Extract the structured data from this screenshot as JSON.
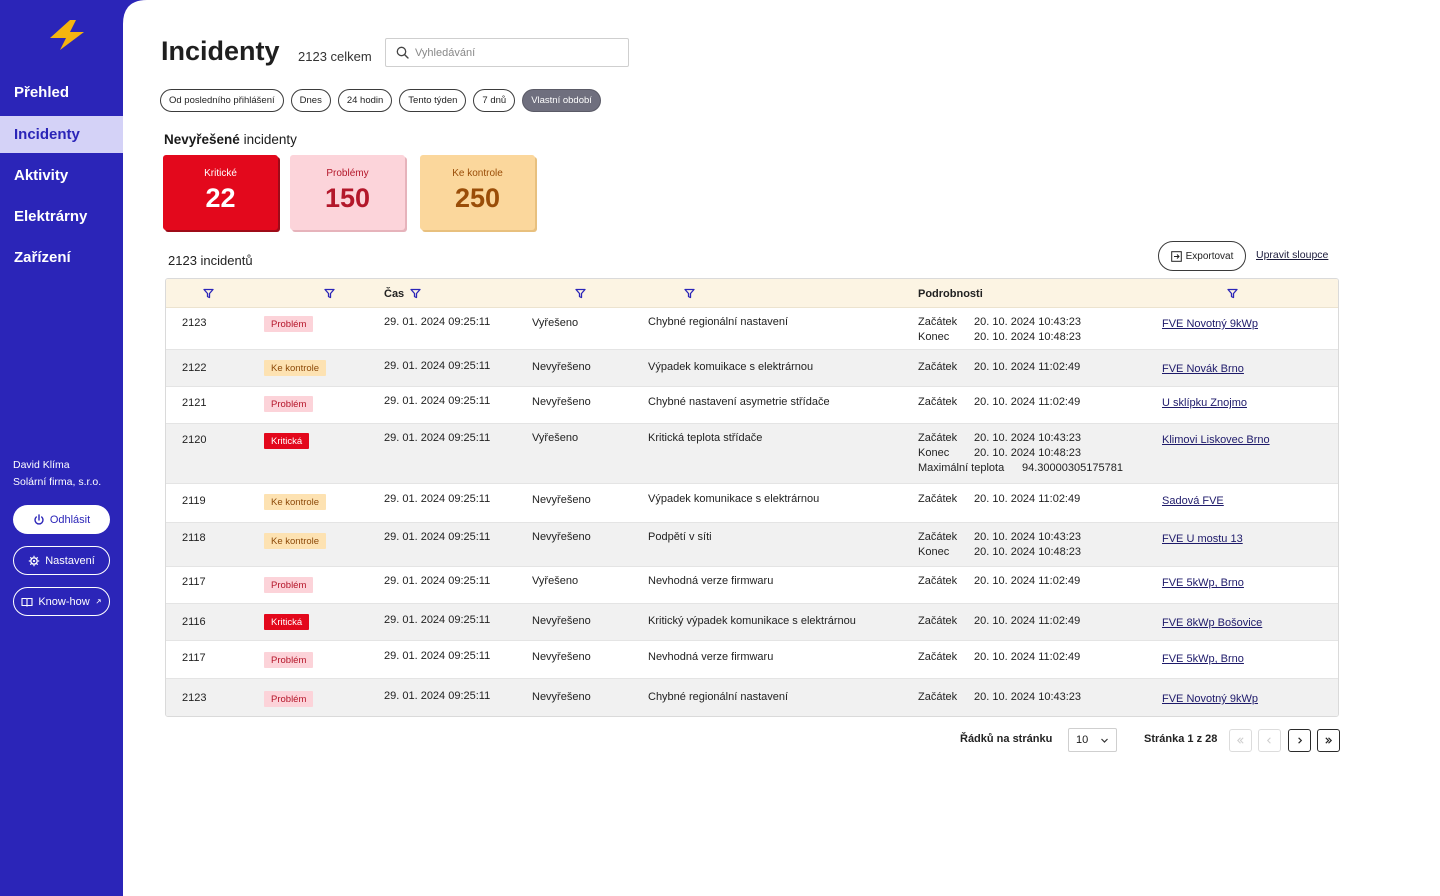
{
  "sidebar": {
    "items": [
      {
        "label": "Přehled"
      },
      {
        "label": "Incidenty"
      },
      {
        "label": "Aktivity"
      },
      {
        "label": "Elektrárny"
      },
      {
        "label": "Zařízení"
      }
    ],
    "user_name": "David Klíma",
    "company": "Solární firma, s.r.o.",
    "logout_label": "Odhlásit",
    "settings_label": "Nastavení",
    "knowhow_label": "Know-how",
    "brand_color": "#2b25b8"
  },
  "header": {
    "title": "Incidenty",
    "total": "2123 celkem",
    "search_placeholder": "Vyhledávání"
  },
  "time_filters": [
    {
      "label": "Od posledního přihlášení",
      "active": false
    },
    {
      "label": "Dnes",
      "active": false
    },
    {
      "label": "24 hodin",
      "active": false
    },
    {
      "label": "Tento týden",
      "active": false
    },
    {
      "label": "7 dnů",
      "active": false
    },
    {
      "label": "Vlastní období",
      "active": true
    }
  ],
  "unresolved": {
    "title_bold": "Nevyřešené",
    "title_rest": " incidenty",
    "cards": [
      {
        "label": "Kritické",
        "value": "22",
        "color": "#e3081c"
      },
      {
        "label": "Problémy",
        "value": "150",
        "color": "#fcd4da"
      },
      {
        "label": "Ke kontrole",
        "value": "250",
        "color": "#fbd79c"
      }
    ]
  },
  "table": {
    "count_label": "2123 incidentů",
    "export_label": "Exportovat",
    "edit_columns_label": "Upravit sloupce",
    "headers": {
      "time": "Čas",
      "details": "Podrobnosti"
    },
    "rows": [
      {
        "id": "2123",
        "type": "Problém",
        "time": "29. 01. 2024 09:25:11",
        "status": "Vyřešeno",
        "title": "Chybné regionální nastavení",
        "details": [
          [
            "Začátek",
            "20. 10. 2024 10:43:23"
          ],
          [
            "Konec",
            "20. 10. 2024 10:48:23"
          ]
        ],
        "plant": "FVE Novotný 9kWp"
      },
      {
        "id": "2122",
        "type": "Ke kontrole",
        "time": "29. 01. 2024 09:25:11",
        "status": "Nevyřešeno",
        "title": "Výpadek komuikace s elektrárnou",
        "details": [
          [
            "Začátek",
            "20. 10. 2024 11:02:49"
          ]
        ],
        "plant": "FVE Novák Brno"
      },
      {
        "id": "2121",
        "type": "Problém",
        "time": "29. 01. 2024 09:25:11",
        "status": "Nevyřešeno",
        "title": "Chybné nastavení asymetrie střídače",
        "details": [
          [
            "Začátek",
            "20. 10. 2024 11:02:49"
          ]
        ],
        "plant": "U sklípku Znojmo"
      },
      {
        "id": "2120",
        "type": "Kritická",
        "time": "29. 01. 2024 09:25:11",
        "status": "Vyřešeno",
        "title": "Kritická teplota střídače",
        "details": [
          [
            "Začátek",
            "20. 10. 2024 10:43:23"
          ],
          [
            "Konec",
            "20. 10. 2024 10:48:23"
          ],
          [
            "Maximální teplota",
            "94.30000305175781"
          ]
        ],
        "plant": "Klimovi Liskovec Brno"
      },
      {
        "id": "2119",
        "type": "Ke kontrole",
        "time": "29. 01. 2024 09:25:11",
        "status": "Nevyřešeno",
        "title": "Výpadek komunikace s elektrárnou",
        "details": [
          [
            "Začátek",
            "20. 10. 2024 11:02:49"
          ]
        ],
        "plant": "Sadová FVE"
      },
      {
        "id": "2118",
        "type": "Ke kontrole",
        "time": "29. 01. 2024 09:25:11",
        "status": "Nevyřešeno",
        "title": "Podpětí v síti",
        "details": [
          [
            "Začátek",
            "20. 10. 2024 10:43:23"
          ],
          [
            "Konec",
            "20. 10. 2024 10:48:23"
          ]
        ],
        "plant": "FVE U mostu 13"
      },
      {
        "id": "2117",
        "type": "Problém",
        "time": "29. 01. 2024 09:25:11",
        "status": "Vyřešeno",
        "title": "Nevhodná verze firmwaru",
        "details": [
          [
            "Začátek",
            "20. 10. 2024 11:02:49"
          ]
        ],
        "plant": "FVE 5kWp, Brno"
      },
      {
        "id": "2116",
        "type": "Kritická",
        "time": "29. 01. 2024 09:25:11",
        "status": "Nevyřešeno",
        "title": "Kritický výpadek komunikace s elektrárnou",
        "details": [
          [
            "Začátek",
            "20. 10. 2024 11:02:49"
          ]
        ],
        "plant": "FVE 8kWp Bošovice"
      },
      {
        "id": "2117",
        "type": "Problém",
        "time": "29. 01. 2024 09:25:11",
        "status": "Nevyřešeno",
        "title": "Nevhodná verze firmwaru",
        "details": [
          [
            "Začátek",
            "20. 10. 2024 11:02:49"
          ]
        ],
        "plant": "FVE 5kWp, Brno"
      },
      {
        "id": "2123",
        "type": "Problém",
        "time": "29. 01. 2024 09:25:11",
        "status": "Nevyřešeno",
        "title": "Chybné regionální nastavení",
        "details": [
          [
            "Začátek",
            "20. 10. 2024 10:43:23"
          ]
        ],
        "plant": "FVE Novotný 9kWp"
      }
    ]
  },
  "pagination": {
    "rows_label": "Řádků na stránku",
    "rows_value": "10",
    "page_info": "Stránka 1 z 28"
  }
}
